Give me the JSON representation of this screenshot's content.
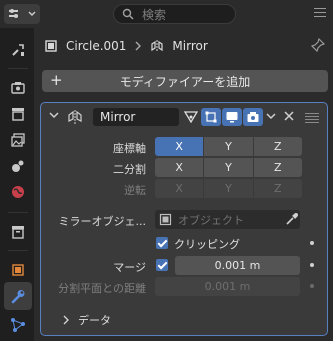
{
  "header": {
    "search_placeholder": "検索"
  },
  "breadcrumb": {
    "object": "Circle.001",
    "modifier": "Mirror"
  },
  "add_modifier_label": "モディファイアーを追加",
  "modifier": {
    "name": "Mirror",
    "axis": {
      "label": "座標軸",
      "buttons": [
        "X",
        "Y",
        "Z"
      ],
      "active": [
        "X"
      ]
    },
    "bisect": {
      "label": "二分割",
      "buttons": [
        "X",
        "Y",
        "Z"
      ]
    },
    "flip": {
      "label": "逆転",
      "buttons": [
        "X",
        "Y",
        "Z"
      ]
    },
    "mirror_object": {
      "label": "ミラーオブジェ...",
      "placeholder": "オブジェクト"
    },
    "clipping": {
      "label": "クリッピング",
      "checked": true
    },
    "merge": {
      "label": "マージ",
      "checked": true,
      "value": "0.001 m"
    },
    "bisect_distance": {
      "label": "分割平面との距離",
      "value": "0.001 m"
    },
    "data_section": "データ"
  },
  "colors": {
    "accent": "#4772b3",
    "panel_outline": "#5680c2",
    "wrench_active": "#5b8de0"
  }
}
